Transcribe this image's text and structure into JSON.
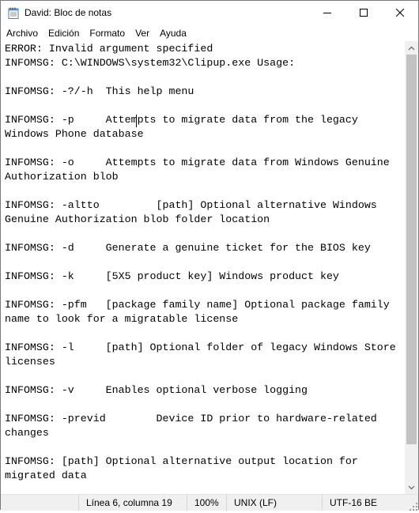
{
  "window": {
    "title": "David: Bloc de notas"
  },
  "menu": {
    "items": [
      "Archivo",
      "Edición",
      "Formato",
      "Ver",
      "Ayuda"
    ]
  },
  "editor": {
    "lines": [
      "ERROR: Invalid argument specified",
      "INFOMSG: C:\\WINDOWS\\system32\\Clipup.exe Usage:",
      "",
      "INFOMSG: -?/-h  This help menu",
      "",
      "INFOMSG: -p     Attempts to migrate data from the legacy",
      "Windows Phone database",
      "",
      "INFOMSG: -o     Attempts to migrate data from Windows Genuine",
      "Authorization blob",
      "",
      "INFOMSG: -altto         [path] Optional alternative Windows",
      "Genuine Authorization blob folder location",
      "",
      "INFOMSG: -d     Generate a genuine ticket for the BIOS key",
      "",
      "INFOMSG: -k     [5X5 product key] Windows product key",
      "",
      "INFOMSG: -pfm   [package family name] Optional package family",
      "name to look for a migratable license",
      "",
      "INFOMSG: -l     [path] Optional folder of legacy Windows Store",
      "licenses",
      "",
      "INFOMSG: -v     Enables optional verbose logging",
      "",
      "INFOMSG: -previd        Device ID prior to hardware-related",
      "changes",
      "",
      "INFOMSG: [path] Optional alternative output location for",
      "migrated data"
    ]
  },
  "statusbar": {
    "position": "Línea 6, columna 19",
    "zoom": "100%",
    "line_ending": "UNIX (LF)",
    "encoding": "UTF-16 BE"
  },
  "icons": {
    "app": "notepad-icon",
    "minimize": "minimize-icon",
    "maximize": "maximize-icon",
    "close": "close-icon"
  }
}
